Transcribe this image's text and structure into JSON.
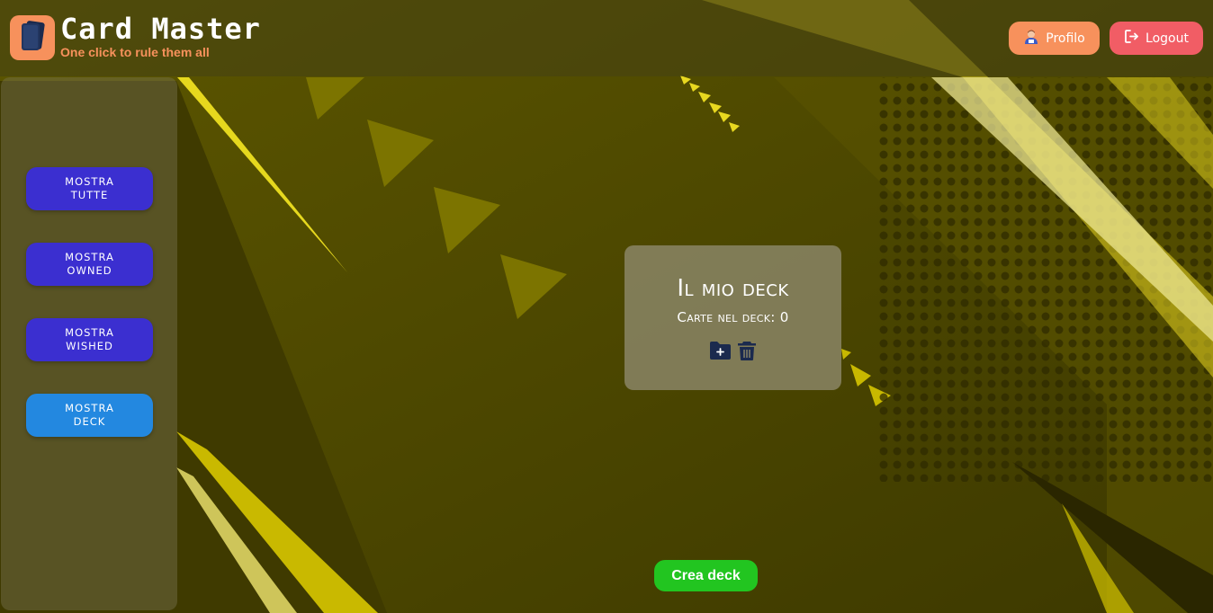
{
  "header": {
    "app_title": "Card Master",
    "app_subtitle": "One click to rule them all",
    "logo_icon": "card-deck-icon",
    "profile_label": "Profilo",
    "profile_icon": "user-avatar-icon",
    "logout_label": "Logout",
    "logout_icon": "logout-icon"
  },
  "sidebar": {
    "items": [
      {
        "label": "Mostra tutte",
        "active": false
      },
      {
        "label": "Mostra owned",
        "active": false
      },
      {
        "label": "Mostra wished",
        "active": false
      },
      {
        "label": "Mostra deck",
        "active": true
      }
    ]
  },
  "deck": {
    "title": "Il mio deck",
    "count_label": "Carte nel deck: 0",
    "add_icon": "folder-add-icon",
    "delete_icon": "trash-icon"
  },
  "actions": {
    "create_deck_label": "Crea deck"
  },
  "colors": {
    "accent_orange": "#f7915c",
    "logout_red": "#f15d65",
    "sidebar_button": "#3b2fd0",
    "sidebar_button_active": "#2388e0",
    "create_green": "#22c520",
    "background_olive": "#4d4800",
    "highlight_yellow": "#e8d820"
  }
}
